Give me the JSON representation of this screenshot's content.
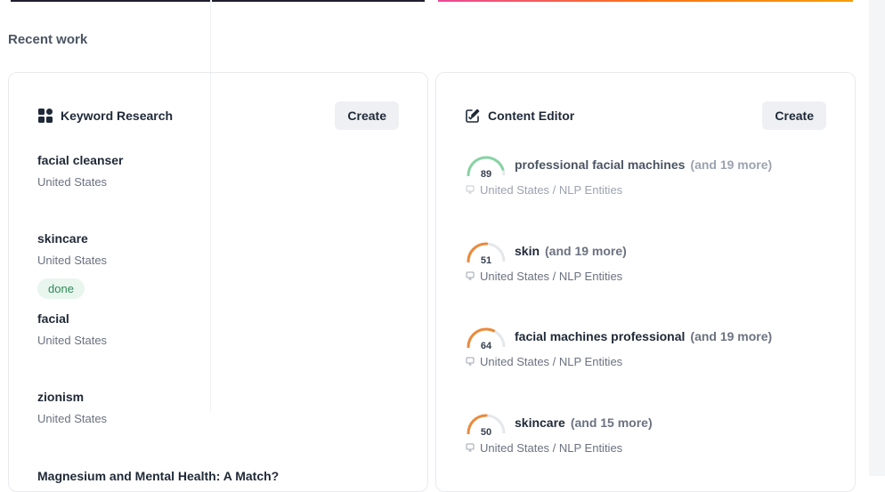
{
  "section_title": "Recent work",
  "keyword_research": {
    "title": "Keyword Research",
    "create_label": "Create",
    "items": [
      {
        "name": "facial cleanser",
        "country": "United States"
      },
      {
        "name": "skincare",
        "country": "United States",
        "badge": "done"
      },
      {
        "name": "facial",
        "country": "United States"
      },
      {
        "name": "zionism",
        "country": "United States"
      },
      {
        "name": "Magnesium and Mental Health: A Match?"
      }
    ]
  },
  "content_editor": {
    "title": "Content Editor",
    "create_label": "Create",
    "items": [
      {
        "score": "89",
        "name": "professional facial machines",
        "more": "(and 19 more)",
        "meta": "United States / NLP Entities",
        "gauge_color": "#86d3a4",
        "gauge_fraction": 0.89
      },
      {
        "score": "51",
        "name": "skin",
        "more": "(and 19 more)",
        "meta": "United States / NLP Entities",
        "gauge_color": "#ea8a3a",
        "gauge_fraction": 0.51
      },
      {
        "score": "64",
        "name": "facial machines professional",
        "more": "(and 19 more)",
        "meta": "United States / NLP Entities",
        "gauge_color": "#ea8a3a",
        "gauge_fraction": 0.64
      },
      {
        "score": "50",
        "name": "skincare",
        "more": "(and 15 more)",
        "meta": "United States / NLP Entities",
        "gauge_color": "#ea8a3a",
        "gauge_fraction": 0.5
      }
    ]
  },
  "icons": {
    "keyword_research": "grid-icon",
    "content_editor": "edit-document-icon",
    "monitor": "monitor-icon"
  }
}
